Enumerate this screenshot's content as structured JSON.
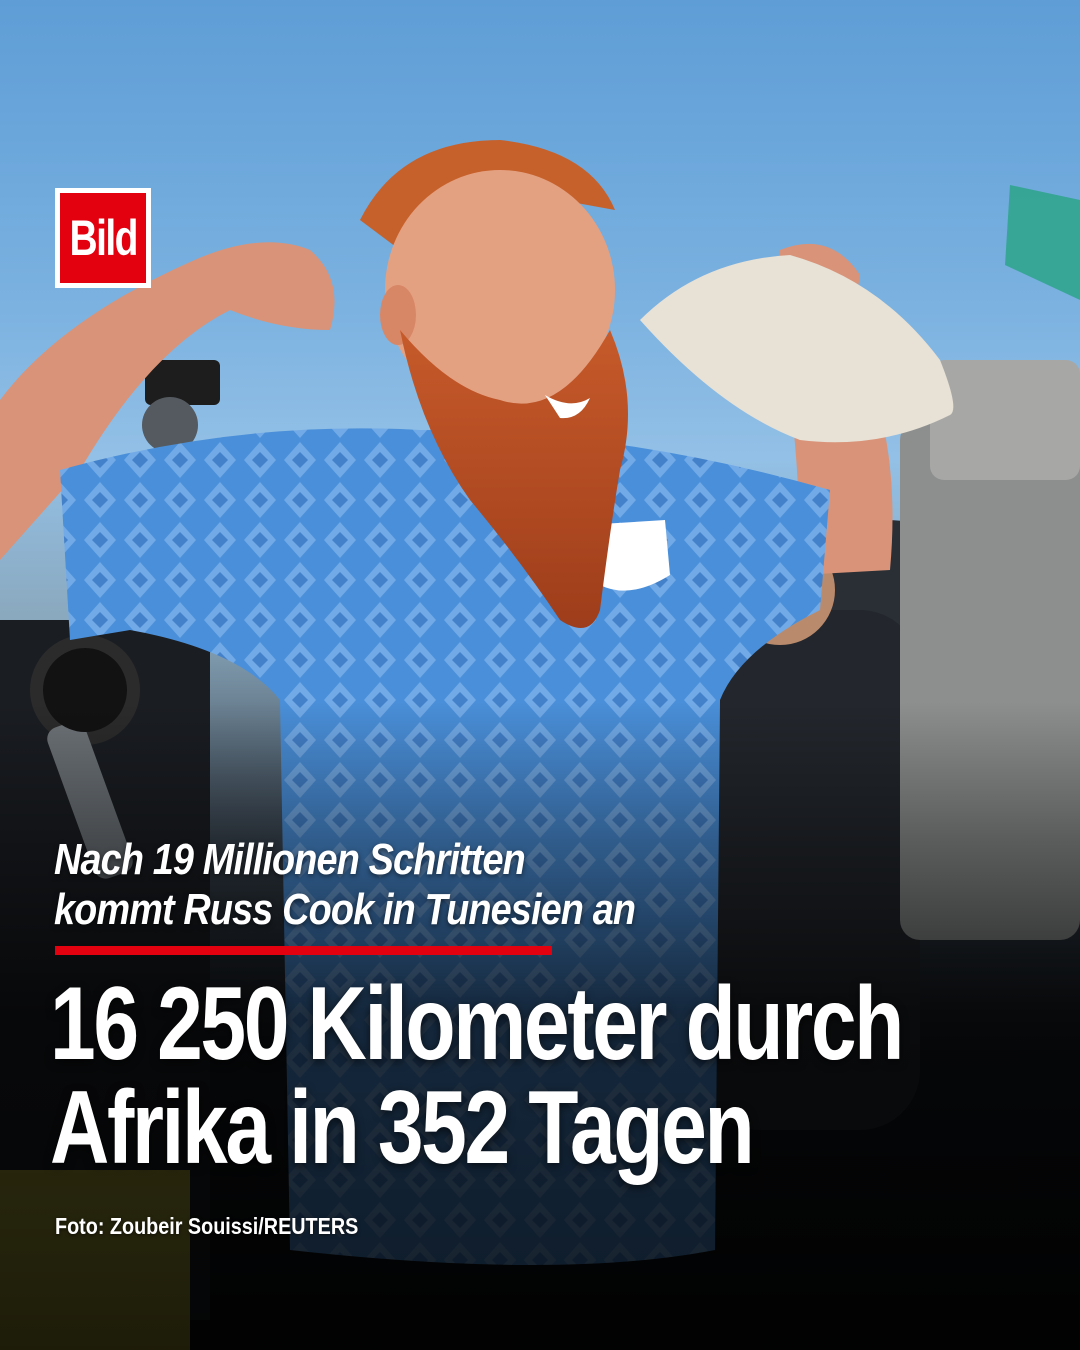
{
  "brand": {
    "logo_text": "Bild",
    "color": "#e3000f"
  },
  "kicker": {
    "line1": "Nach 19 Millionen Schritten",
    "line2": "kommt Russ Cook in Tunesien an"
  },
  "headline": {
    "line1": "16 250 Kilometer durch",
    "line2": "Afrika in 352 Tagen"
  },
  "credit": "Foto: Zoubeir Souissi/REUTERS",
  "colors": {
    "sky": "#7ab1e0",
    "jersey": "#4f8fd8",
    "beard": "#c4552b",
    "text": "#ffffff"
  }
}
